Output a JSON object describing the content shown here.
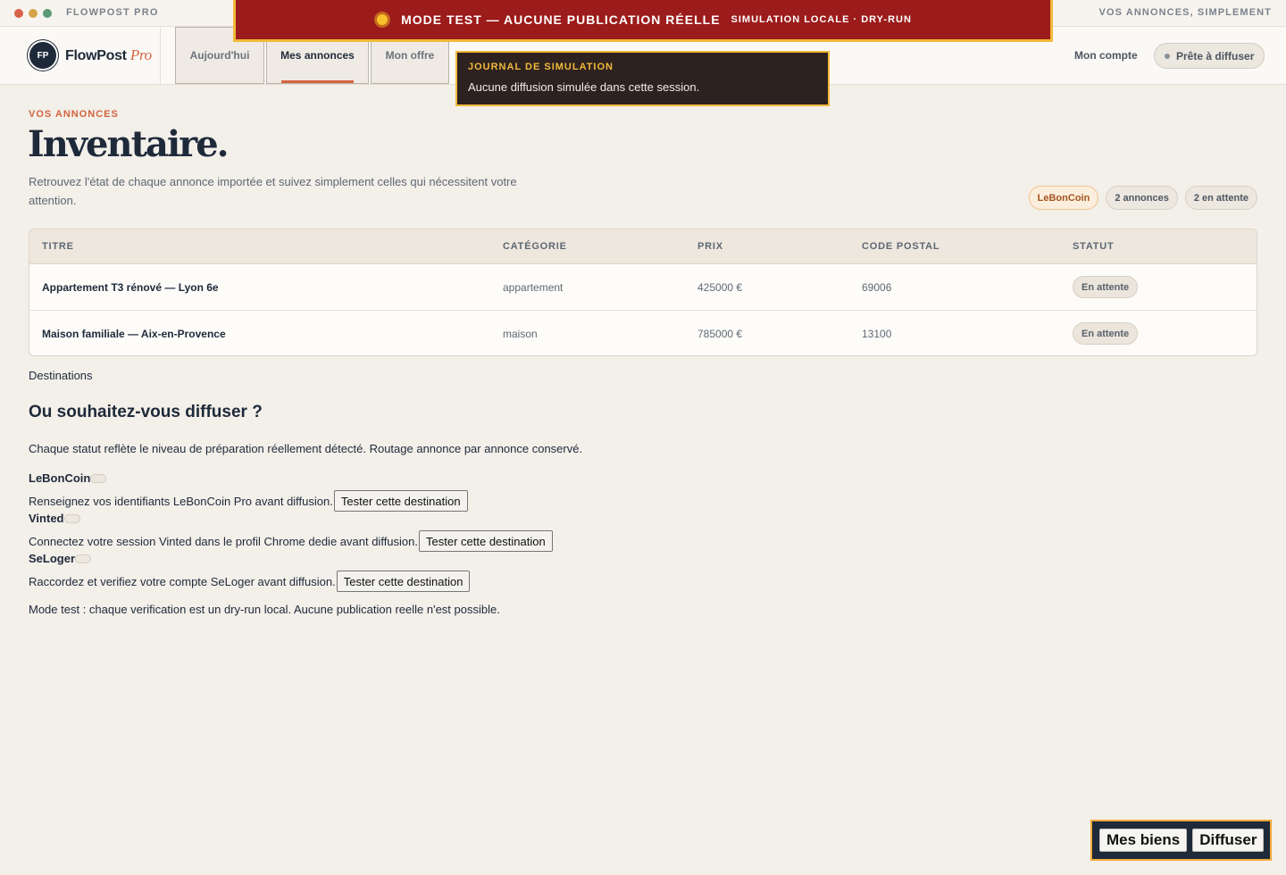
{
  "app": {
    "name": "FLOWPOST PRO",
    "tagline": "VOS ANNONCES, SIMPLEMENT",
    "brand": "FlowPost",
    "brand_suffix": "Pro",
    "logo_initials": "FP"
  },
  "banner": {
    "main": "MODE TEST — AUCUNE PUBLICATION RÉELLE",
    "sub": "SIMULATION LOCALE · DRY-RUN"
  },
  "nav": {
    "tabs": [
      {
        "label": "Aujourd'hui",
        "active": false
      },
      {
        "label": "Mes annonces",
        "active": true
      },
      {
        "label": "Mon offre",
        "active": false
      }
    ],
    "account": "Mon compte",
    "status_pill": "Prête à diffuser"
  },
  "simlog": {
    "title": "JOURNAL DE SIMULATION",
    "text": "Aucune diffusion simulée dans cette session."
  },
  "main": {
    "eyebrow": "VOS ANNONCES",
    "title": "Inventaire.",
    "description": "Retrouvez l'état de chaque annonce importée et suivez simplement celles qui nécessitent votre attention.",
    "chips": [
      "LeBonCoin",
      "2 annonces",
      "2 en attente"
    ]
  },
  "table": {
    "headers": [
      "TITRE",
      "CATÉGORIE",
      "PRIX",
      "CODE POSTAL",
      "STATUT"
    ],
    "rows": [
      {
        "title": "Appartement T3 rénové — Lyon 6e",
        "category": "appartement",
        "price": "425000 €",
        "postal": "69006",
        "status": "En attente"
      },
      {
        "title": "Maison familiale — Aix-en-Provence",
        "category": "maison",
        "price": "785000 €",
        "postal": "13100",
        "status": "En attente"
      }
    ]
  },
  "destinations": {
    "label": "Destinations",
    "title": "Ou souhaitez-vous diffuser ?",
    "description": "Chaque statut reflète le niveau de préparation réellement détecté. Routage annonce par annonce conservé.",
    "items": [
      {
        "name": "LeBonCoin",
        "text": "Renseignez vos identifiants LeBonCoin Pro avant diffusion.",
        "button": "Tester cette destination"
      },
      {
        "name": "Vinted",
        "text": "Connectez votre session Vinted dans le profil Chrome dedie avant diffusion.",
        "button": "Tester cette destination"
      },
      {
        "name": "SeLoger",
        "text": "Raccordez et verifiez votre compte SeLoger avant diffusion.",
        "button": "Tester cette destination"
      }
    ],
    "note": "Mode test : chaque verification est un dry-run local. Aucune publication reelle n'est possible."
  },
  "dock": {
    "buttons": [
      "Mes biens",
      "Diffuser"
    ]
  }
}
